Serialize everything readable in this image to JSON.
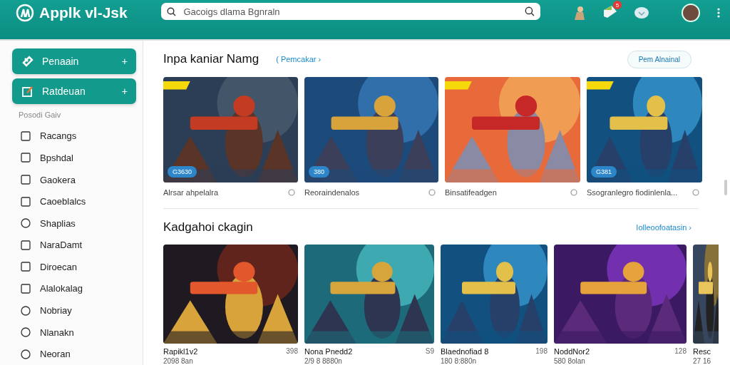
{
  "header": {
    "logo": "Applk vl-Jsk",
    "search": {
      "placeholder": "Gacoigs dlama Bgnraln"
    },
    "notification_badge": "5"
  },
  "sidebar": {
    "buttons": [
      {
        "label": "Penaain",
        "plus": "+"
      },
      {
        "label": "Ratdeuan",
        "plus": "+"
      }
    ],
    "section": "Posodi Gaiv",
    "items": [
      {
        "label": "Racangs",
        "kind": "square"
      },
      {
        "label": "Bpshdal",
        "kind": "square"
      },
      {
        "label": "Gaokera",
        "kind": "square"
      },
      {
        "label": "Caoeblalcs",
        "kind": "square"
      },
      {
        "label": "Shaplias",
        "kind": "round"
      },
      {
        "label": "NaraDamt",
        "kind": "square"
      },
      {
        "label": "Diroecan",
        "kind": "square"
      },
      {
        "label": "Alalokalag",
        "kind": "square"
      },
      {
        "label": "Nobriay",
        "kind": "round"
      },
      {
        "label": "Nlanakn",
        "kind": "round"
      },
      {
        "label": "Neoran",
        "kind": "round"
      }
    ]
  },
  "featured": {
    "title": "Inpa kaniar Namg",
    "link": "( Pemcakar ›",
    "button": "Pem Alnainal",
    "cards": [
      {
        "badge": "G3630",
        "caption": "Alrsar ahpelalra",
        "tag": true
      },
      {
        "badge": "380",
        "caption": "Reoraindenalos",
        "tag": false
      },
      {
        "caption": "Binsatifeadgen",
        "tag": true
      },
      {
        "badge": "G381",
        "caption": "Ssogranlegro fiodinlenla...",
        "tag": true
      }
    ]
  },
  "section2": {
    "title": "Kadgahoi ckagin",
    "link": "Iolleoofoatasin ›",
    "cards": [
      {
        "title": "Rapikl1v2",
        "count": "398",
        "meta": "2098 8an"
      },
      {
        "title": "Nona Pnedd2",
        "count": "S9",
        "meta": "2/9 8 8880n"
      },
      {
        "title": "Blaednofiad 8",
        "count": "198",
        "meta": "180 8:880n"
      },
      {
        "title": "NoddNor2",
        "count": "128",
        "meta": "580 8olan"
      },
      {
        "title": "Resc",
        "meta": "27 16"
      }
    ]
  }
}
